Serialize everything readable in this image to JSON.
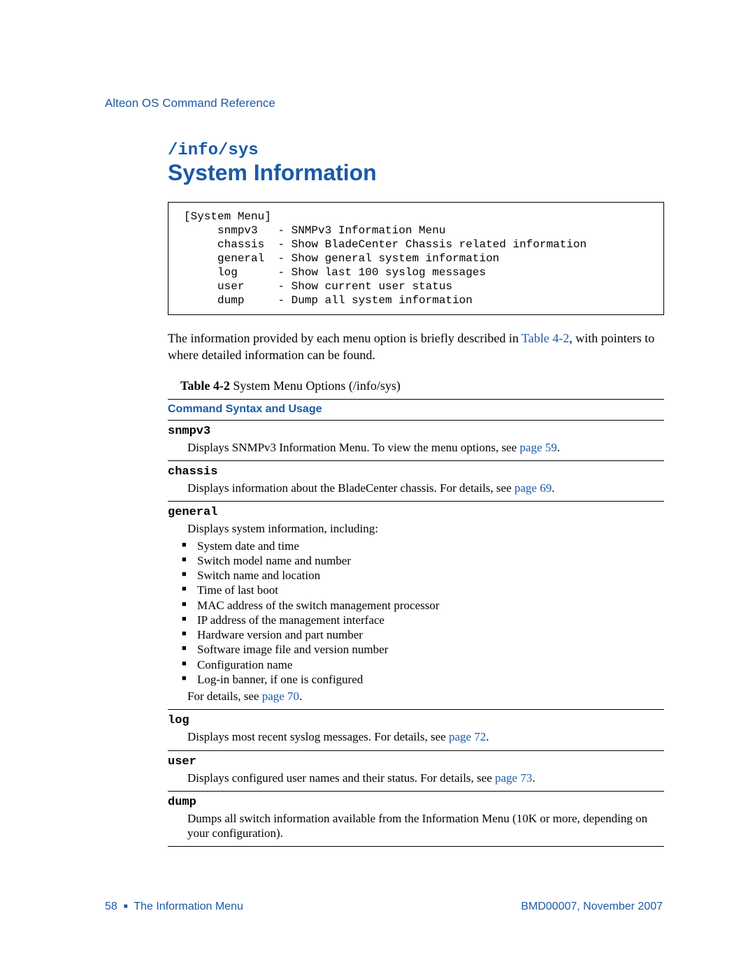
{
  "header": {
    "running_head": "Alteon OS Command Reference"
  },
  "section": {
    "command_path": "/info/sys",
    "title": "System Information"
  },
  "codebox": "[System Menu]\n     snmpv3   - SNMPv3 Information Menu\n     chassis  - Show BladeCenter Chassis related information\n     general  - Show general system information\n     log      - Show last 100 syslog messages\n     user     - Show current user status\n     dump     - Dump all system information",
  "intro": {
    "text_before_link": "The information provided by each menu option is briefly described in ",
    "link": "Table 4-2",
    "text_after_link": ", with pointers to where detailed information can be found."
  },
  "table": {
    "caption_label": "Table 4-2",
    "caption_text": "  System Menu Options (/info/sys)",
    "header": "Command Syntax and Usage",
    "rows": {
      "snmpv3": {
        "cmd": "snmpv3",
        "desc_before": "Displays SNMPv3 Information Menu. To view the menu options, see ",
        "link": "page 59",
        "desc_after": "."
      },
      "chassis": {
        "cmd": "chassis",
        "desc_before": "Displays information about the BladeCenter chassis. For details, see ",
        "link": "page 69",
        "desc_after": "."
      },
      "general": {
        "cmd": "general",
        "intro": "Displays system information, including:",
        "items": [
          "System date and time",
          "Switch model name and number",
          "Switch name and location",
          "Time of last boot",
          "MAC address of the switch management processor",
          "IP address of the management interface",
          "Hardware version and part number",
          "Software image file and version number",
          "Configuration name",
          "Log-in banner, if one is configured"
        ],
        "outro_before": "For details, see ",
        "outro_link": "page 70",
        "outro_after": "."
      },
      "log": {
        "cmd": "log",
        "desc_before": "Displays most recent syslog messages. For details, see ",
        "link": "page 72",
        "desc_after": "."
      },
      "user": {
        "cmd": "user",
        "desc_before": "Displays configured user names and their status. For details, see ",
        "link": "page 73",
        "desc_after": "."
      },
      "dump": {
        "cmd": "dump",
        "desc": "Dumps all switch information available from the Information Menu (10K or more, depending on your configuration)."
      }
    }
  },
  "footer": {
    "page_number": "58",
    "chapter": "The Information Menu",
    "doc_id": "BMD00007, November 2007"
  }
}
